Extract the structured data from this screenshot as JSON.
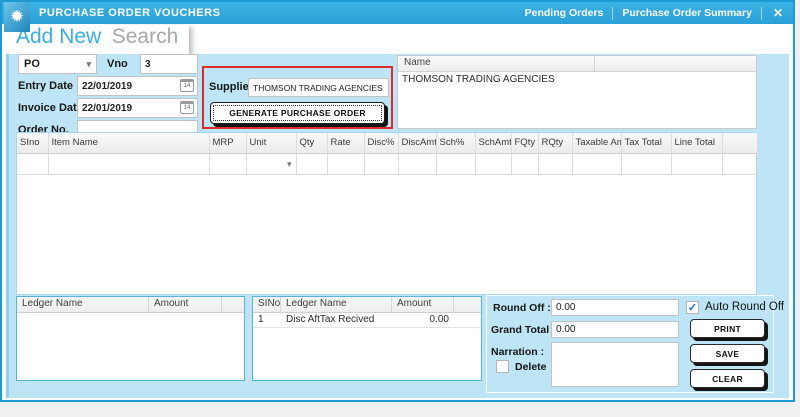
{
  "icons": {
    "star": "✹",
    "dropdown": "▾",
    "check": "✓",
    "close": "✕"
  },
  "colors": {
    "titlebar": "#2fa7dd",
    "panel": "#bde5f5",
    "window_border": "#1b9ad3",
    "highlight_red": "#dd2b2b",
    "check_blue": "#1d6fd1"
  },
  "window": {
    "title": "PURCHASE ORDER VOUCHERS",
    "links": [
      "Pending Orders",
      "Purchase Order Summary"
    ]
  },
  "tabs": {
    "active": "Add New",
    "inactive": "Search"
  },
  "form": {
    "voucher_type": "PO",
    "vno_label": "Vno",
    "vno_value": "3",
    "entry_date_label": "Entry Date",
    "entry_date_value": "22/01/2019",
    "invoice_date_label": "Invoice Date",
    "invoice_date_value": "22/01/2019",
    "order_no_label": "Order No.",
    "order_no_value": "",
    "calendar_day": "14",
    "supplier_label": "Supplier",
    "supplier_value": "THOMSON TRADING AGENCIES",
    "generate_button": "GENERATE PURCHASE ORDER"
  },
  "name_grid": {
    "header": "Name",
    "rows": [
      "THOMSON TRADING AGENCIES"
    ]
  },
  "items_table": {
    "headers": [
      "SIno",
      "Item Name",
      "MRP",
      "Unit",
      "Qty",
      "Rate",
      "Disc%",
      "DiscAmt",
      "Sch%",
      "SchAmt",
      "FQty",
      "RQty",
      "Taxable Am",
      "Tax Total",
      "Line Total"
    ]
  },
  "ledger_left": {
    "headers": [
      "Ledger Name",
      "Amount"
    ]
  },
  "ledger_mid": {
    "headers": [
      "SINo",
      "Ledger Name",
      "Amount"
    ],
    "rows": [
      {
        "slno": "1",
        "name": "Disc AftTax Recived",
        "amount": "0.00"
      }
    ]
  },
  "totals": {
    "round_off_label": "Round Off :",
    "round_off_value": "0.00",
    "grand_total_label": "Grand Total :",
    "grand_total_value": "0.00",
    "narration_label": "Narration :",
    "delete_label": "Delete",
    "auto_round_off_label": "Auto Round Off"
  },
  "buttons": {
    "print": "PRINT",
    "save": "SAVE",
    "clear": "CLEAR"
  }
}
